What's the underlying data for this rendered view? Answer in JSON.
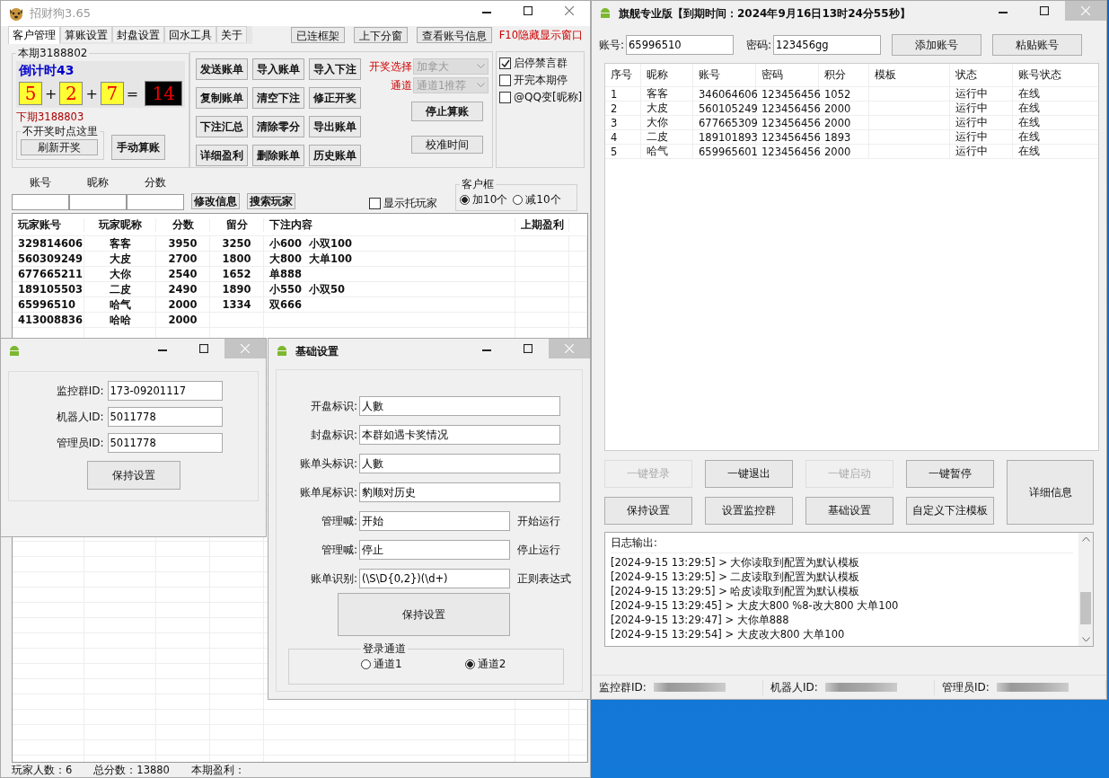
{
  "main_window": {
    "title": "招财狗3.65",
    "tabs": [
      {
        "label": "客户管理",
        "selected": true
      },
      {
        "label": "算账设置",
        "selected": false
      },
      {
        "label": "封盘设置",
        "selected": false
      },
      {
        "label": "回水工具",
        "selected": false
      },
      {
        "label": "关于",
        "selected": false
      }
    ],
    "toolbar_buttons": [
      "已连框架",
      "上下分窗",
      "查看账号信息"
    ],
    "hotkey_hint": "F10隐藏显示窗口",
    "draw_panel": {
      "title": "本期3188802",
      "countdown": "倒计时43",
      "numbers": [
        "5",
        "2",
        "7"
      ],
      "operators": [
        "+",
        "+",
        "="
      ],
      "sum": "14",
      "next_period": "下期3188803",
      "refresh_group": {
        "title": "不开奖时点这里",
        "button": "刷新开奖"
      },
      "manual_button": "手动算账"
    },
    "action_buttons": [
      "发送账单",
      "导入账单",
      "导入下注",
      "复制账单",
      "清空下注",
      "修正开奖",
      "下注汇总",
      "清除零分",
      "导出账单",
      "详细盈利",
      "删除账单",
      "历史账单"
    ],
    "draw_select": {
      "label": "开奖选择",
      "value": "加拿大",
      "disabled": true
    },
    "channel_select": {
      "label": "通道",
      "value": "通道1推荐",
      "disabled": true
    },
    "side_buttons": [
      "停止算账",
      "校准时间"
    ],
    "options": [
      {
        "label": "启停禁言群",
        "checked": true
      },
      {
        "label": "开完本期停",
        "checked": false
      },
      {
        "label": "@QQ变[昵称]",
        "checked": false
      }
    ],
    "player_form": {
      "fields": [
        "账号",
        "昵称",
        "分数"
      ],
      "buttons": [
        "修改信息",
        "搜索玩家"
      ],
      "show_shill": {
        "label": "显示托玩家",
        "checked": false
      }
    },
    "client_box": {
      "title": "客户框",
      "options": [
        {
          "label": "加10个",
          "selected": true
        },
        {
          "label": "减10个",
          "selected": false
        }
      ]
    },
    "table": {
      "columns": [
        "玩家账号",
        "玩家昵称",
        "分数",
        "留分",
        "下注内容",
        "上期盈利"
      ],
      "rows": [
        [
          "329814606",
          "客客",
          "3950",
          "3250",
          "小600  小双100"
        ],
        [
          "560309249",
          "大皮",
          "2700",
          "1800",
          "大800  大单100"
        ],
        [
          "677665211",
          "大你",
          "2540",
          "1652",
          "单888"
        ],
        [
          "189105503",
          "二皮",
          "2490",
          "1890",
          "小550  小双50"
        ],
        [
          "65996510",
          "哈气",
          "2000",
          "1334",
          "双666"
        ],
        [
          "413008836",
          "哈哈",
          "2000"
        ]
      ]
    },
    "status_bar": [
      "玩家人数：6",
      "总分数：13880",
      "本期盈利："
    ]
  },
  "id_window": {
    "fields": [
      {
        "label": "监控群ID:",
        "value": "173-09201117"
      },
      {
        "label": "机器人ID:",
        "value": "5011778"
      },
      {
        "label": "管理员ID:",
        "value": "5011778"
      }
    ],
    "button": "保持设置"
  },
  "settings_window": {
    "title": "基础设置",
    "fields": [
      {
        "label": "开盘标识:",
        "value": "人數"
      },
      {
        "label": "封盘标识:",
        "value": "本群如遇卡奖情况"
      },
      {
        "label": "账单头标识:",
        "value": "人數"
      },
      {
        "label": "账单尾标识:",
        "value": "豹顺对历史"
      },
      {
        "label": "管理喊:",
        "value": "开始",
        "note": "开始运行"
      },
      {
        "label": "管理喊:",
        "value": "停止",
        "note": "停止运行"
      },
      {
        "label": "账单识别:",
        "value": "(\\S\\D{0,2})(\\d+)",
        "note": "正则表达式"
      }
    ],
    "button": "保持设置",
    "login_channel": {
      "title": "登录通道",
      "options": [
        {
          "label": "通道1",
          "selected": false
        },
        {
          "label": "通道2",
          "selected": true
        }
      ]
    }
  },
  "pro_window": {
    "title": "旗舰专业版【到期时间：2024年9月16日13时24分55秒】",
    "account": {
      "label": "账号:",
      "value": "65996510"
    },
    "password": {
      "label": "密码:",
      "value": "123456gg"
    },
    "buttons": [
      "添加账号",
      "粘贴账号"
    ],
    "table": {
      "columns": [
        "序号",
        "昵称",
        "账号",
        "密码",
        "积分",
        "模板",
        "状态",
        "账号状态"
      ],
      "rows": [
        [
          "1",
          "客客",
          "346064606",
          "123456456",
          "1052",
          null,
          "运行中",
          "在线"
        ],
        [
          "2",
          "大皮",
          "560105249",
          "123456456",
          "2000",
          null,
          "运行中",
          "在线"
        ],
        [
          "3",
          "大你",
          "677665309",
          "123456456",
          "2000",
          null,
          "运行中",
          "在线"
        ],
        [
          "4",
          "二皮",
          "189101893",
          "123456456",
          "1893",
          null,
          "运行中",
          "在线"
        ],
        [
          "5",
          "哈气",
          "659965601",
          "123456456",
          "2000",
          null,
          "运行中",
          "在线"
        ]
      ]
    },
    "action_buttons": [
      {
        "label": "一键登录",
        "disabled": true
      },
      {
        "label": "一键退出",
        "disabled": false
      },
      {
        "label": "一键启动",
        "disabled": true
      },
      {
        "label": "一键暂停",
        "disabled": false
      },
      {
        "label": "保持设置",
        "disabled": false
      },
      {
        "label": "设置监控群",
        "disabled": false
      },
      {
        "label": "基础设置",
        "disabled": false
      },
      {
        "label": "自定义下注模板",
        "disabled": false
      }
    ],
    "detail_button": "详细信息",
    "log": {
      "title": "日志输出:",
      "lines": [
        "[2024-9-15 13:29:5] > 大你读取到配置为默认模板",
        "[2024-9-15 13:29:5] > 二皮读取到配置为默认模板",
        "[2024-9-15 13:29:5] > 哈皮读取到配置为默认模板",
        "[2024-9-15 13:29:45] > 大皮大800 %8-改大800 大单100",
        "[2024-9-15 13:29:47] > 大你单888",
        "[2024-9-15 13:29:54] > 大皮改大800 大单100"
      ]
    },
    "status_bar": [
      "监控群ID:",
      "机器人ID:",
      "管理员ID:"
    ]
  }
}
